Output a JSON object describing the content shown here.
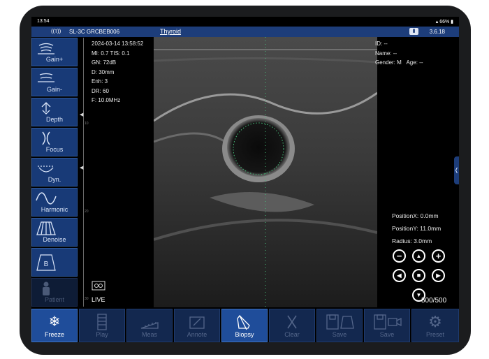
{
  "status_bar": {
    "time": "13:54",
    "battery": "66%"
  },
  "app_bar": {
    "device": "SL-3C GRCBEB006",
    "preset": "Thyroid",
    "version": "3.6.18"
  },
  "params": [
    "2024-03-14 13:58:52",
    "MI: 0.7  TIS: 0.1",
    "GN: 72dB",
    "D: 30mm",
    "Enh: 3",
    "DR: 60",
    "F: 10.0MHz"
  ],
  "patient": {
    "id": "ID: --",
    "name": "Name: --",
    "gender": "Gender: M",
    "age": "Age: --"
  },
  "scale_labels": [
    "10",
    "20",
    "30"
  ],
  "live_label": "LIVE",
  "measure": {
    "x": "PositionX: 0.0mm",
    "y": "PositionY: 11.0mm",
    "r": "Radius: 3.0mm"
  },
  "frame_counter": "500/500",
  "left_toolbar": [
    {
      "label": "Gain+",
      "icon": "gain-up-icon"
    },
    {
      "label": "Gain-",
      "icon": "gain-down-icon"
    },
    {
      "label": "Depth",
      "icon": "depth-icon"
    },
    {
      "label": "Focus",
      "icon": "focus-icon"
    },
    {
      "label": "Dyn.",
      "icon": "dynamic-range-icon"
    },
    {
      "label": "Harmonic",
      "icon": "harmonic-icon"
    },
    {
      "label": "Denoise",
      "icon": "denoise-icon"
    },
    {
      "label": "",
      "icon": "b-mode-icon"
    },
    {
      "label": "Patient",
      "icon": "patient-icon"
    }
  ],
  "bottom_toolbar": [
    {
      "label": "Freeze",
      "icon": "snowflake-icon"
    },
    {
      "label": "Play",
      "icon": "film-icon"
    },
    {
      "label": "Meas",
      "icon": "ruler-icon"
    },
    {
      "label": "Annote",
      "icon": "annotate-icon"
    },
    {
      "label": "Biopsy",
      "icon": "biopsy-icon"
    },
    {
      "label": "Clear",
      "icon": "clear-icon"
    },
    {
      "label": "Save",
      "icon": "save-image-icon"
    },
    {
      "label": "Save",
      "icon": "save-video-icon"
    },
    {
      "label": "Preset",
      "icon": "gear-icon"
    }
  ]
}
